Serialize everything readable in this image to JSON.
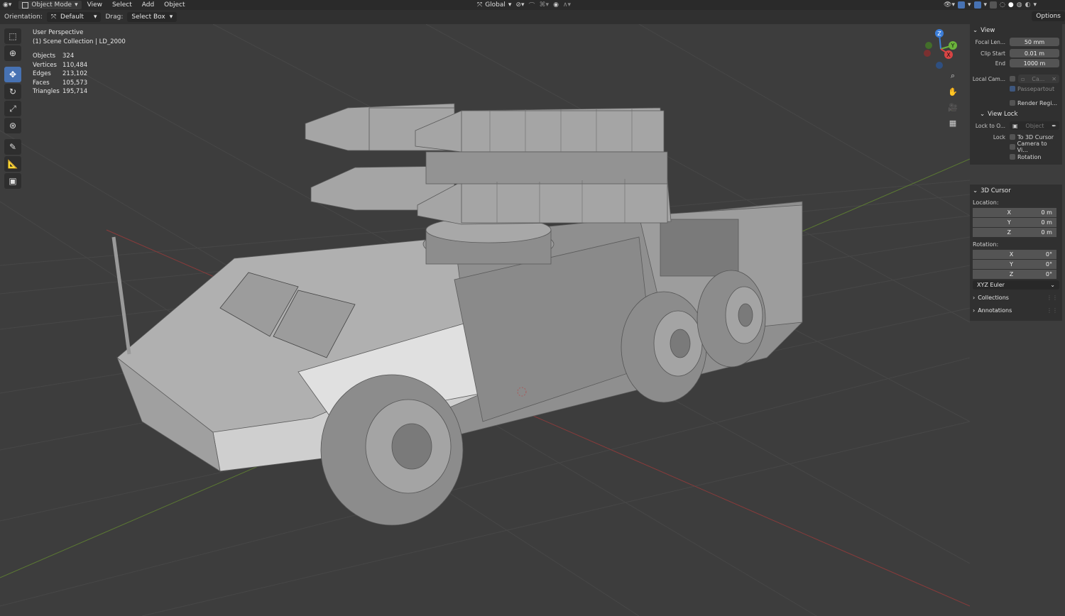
{
  "menu": {
    "mode": "Object Mode",
    "items": [
      "View",
      "Select",
      "Add",
      "Object"
    ]
  },
  "header": {
    "transform_orientation": "Global",
    "orientation_label": "Orientation:",
    "orientation_value": "Default",
    "drag_label": "Drag:",
    "drag_value": "Select Box",
    "options_label": "Options"
  },
  "overlay": {
    "view_name": "User Perspective",
    "collection": "(1) Scene Collection | LD_2000",
    "stats": [
      {
        "label": "Objects",
        "value": "324"
      },
      {
        "label": "Vertices",
        "value": "110,484"
      },
      {
        "label": "Edges",
        "value": "213,102"
      },
      {
        "label": "Faces",
        "value": "105,573"
      },
      {
        "label": "Triangles",
        "value": "195,714"
      }
    ]
  },
  "gizmo": {
    "x": "X",
    "y": "Y",
    "z": "Z"
  },
  "npanel": {
    "view": {
      "title": "View",
      "focal_label": "Focal Len...",
      "focal_value": "50 mm",
      "clip_start_label": "Clip Start",
      "clip_start_value": "0.01 m",
      "end_label": "End",
      "end_value": "1000 m",
      "local_cam_label": "Local Cam...",
      "local_cam_value": "Ca...",
      "passepartout": "Passepartout",
      "render_region": "Render Regi..."
    },
    "view_lock": {
      "title": "View Lock",
      "lock_to_label": "Lock to O...",
      "lock_to_placeholder": "Object",
      "lock_label": "Lock",
      "to_cursor": "To 3D Cursor",
      "camera_to_view": "Camera to Vi...",
      "rotation": "Rotation"
    },
    "cursor": {
      "title": "3D Cursor",
      "location_label": "Location:",
      "location": [
        {
          "axis": "X",
          "value": "0 m"
        },
        {
          "axis": "Y",
          "value": "0 m"
        },
        {
          "axis": "Z",
          "value": "0 m"
        }
      ],
      "rotation_label": "Rotation:",
      "rotation": [
        {
          "axis": "X",
          "value": "0°"
        },
        {
          "axis": "Y",
          "value": "0°"
        },
        {
          "axis": "Z",
          "value": "0°"
        }
      ],
      "rotation_mode": "XYZ Euler"
    },
    "collections_title": "Collections",
    "annotations_title": "Annotations"
  }
}
